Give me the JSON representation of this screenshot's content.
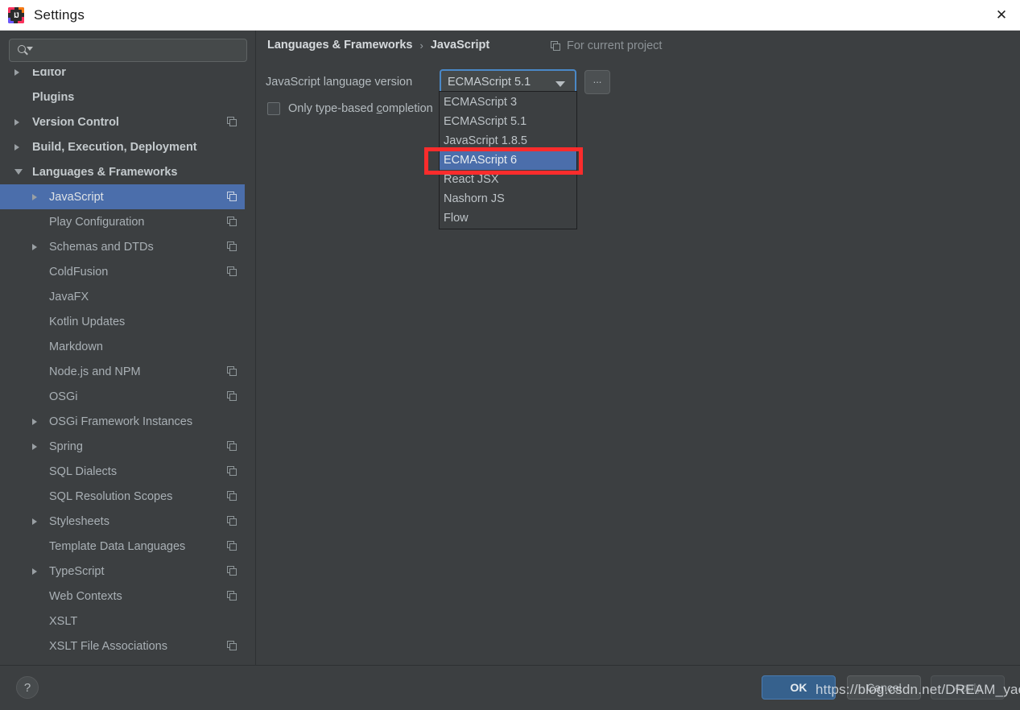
{
  "window": {
    "title": "Settings",
    "logo_icon": "intellij-idea-icon",
    "close_icon": "close-icon"
  },
  "search": {
    "icon": "search-icon",
    "value": "",
    "placeholder": ""
  },
  "sidebar": {
    "scrollbar": "vertical-scrollbar",
    "items": [
      {
        "label": "Editor",
        "level": 0,
        "bold": true,
        "arrow": "right",
        "badge": false,
        "selected": false,
        "clipped": true
      },
      {
        "label": "Plugins",
        "level": 0,
        "bold": true,
        "arrow": "none",
        "badge": false,
        "selected": false
      },
      {
        "label": "Version Control",
        "level": 0,
        "bold": true,
        "arrow": "right",
        "badge": true,
        "selected": false
      },
      {
        "label": "Build, Execution, Deployment",
        "level": 0,
        "bold": true,
        "arrow": "right",
        "badge": false,
        "selected": false
      },
      {
        "label": "Languages & Frameworks",
        "level": 0,
        "bold": true,
        "arrow": "down",
        "badge": false,
        "selected": false
      },
      {
        "label": "JavaScript",
        "level": 1,
        "bold": false,
        "arrow": "right",
        "badge": true,
        "selected": true
      },
      {
        "label": "Play Configuration",
        "level": 1,
        "bold": false,
        "arrow": "none",
        "badge": true,
        "selected": false
      },
      {
        "label": "Schemas and DTDs",
        "level": 1,
        "bold": false,
        "arrow": "right",
        "badge": true,
        "selected": false
      },
      {
        "label": "ColdFusion",
        "level": 1,
        "bold": false,
        "arrow": "none",
        "badge": true,
        "selected": false
      },
      {
        "label": "JavaFX",
        "level": 1,
        "bold": false,
        "arrow": "none",
        "badge": false,
        "selected": false
      },
      {
        "label": "Kotlin Updates",
        "level": 1,
        "bold": false,
        "arrow": "none",
        "badge": false,
        "selected": false
      },
      {
        "label": "Markdown",
        "level": 1,
        "bold": false,
        "arrow": "none",
        "badge": false,
        "selected": false
      },
      {
        "label": "Node.js and NPM",
        "level": 1,
        "bold": false,
        "arrow": "none",
        "badge": true,
        "selected": false
      },
      {
        "label": "OSGi",
        "level": 1,
        "bold": false,
        "arrow": "none",
        "badge": true,
        "selected": false
      },
      {
        "label": "OSGi Framework Instances",
        "level": 1,
        "bold": false,
        "arrow": "right",
        "badge": false,
        "selected": false
      },
      {
        "label": "Spring",
        "level": 1,
        "bold": false,
        "arrow": "right",
        "badge": true,
        "selected": false
      },
      {
        "label": "SQL Dialects",
        "level": 1,
        "bold": false,
        "arrow": "none",
        "badge": true,
        "selected": false
      },
      {
        "label": "SQL Resolution Scopes",
        "level": 1,
        "bold": false,
        "arrow": "none",
        "badge": true,
        "selected": false
      },
      {
        "label": "Stylesheets",
        "level": 1,
        "bold": false,
        "arrow": "right",
        "badge": true,
        "selected": false
      },
      {
        "label": "Template Data Languages",
        "level": 1,
        "bold": false,
        "arrow": "none",
        "badge": true,
        "selected": false
      },
      {
        "label": "TypeScript",
        "level": 1,
        "bold": false,
        "arrow": "right",
        "badge": true,
        "selected": false
      },
      {
        "label": "Web Contexts",
        "level": 1,
        "bold": false,
        "arrow": "none",
        "badge": true,
        "selected": false
      },
      {
        "label": "XSLT",
        "level": 1,
        "bold": false,
        "arrow": "none",
        "badge": false,
        "selected": false
      },
      {
        "label": "XSLT File Associations",
        "level": 1,
        "bold": false,
        "arrow": "none",
        "badge": true,
        "selected": false
      }
    ]
  },
  "content": {
    "breadcrumb": {
      "parent": "Languages & Frameworks",
      "separator": "›",
      "current": "JavaScript"
    },
    "project_note": {
      "icon": "project-scope-icon",
      "text": "For current project"
    },
    "language_version": {
      "label": "JavaScript language version",
      "selected": "ECMAScript 5.1",
      "caret_icon": "chevron-down-icon",
      "browse_label": "..."
    },
    "type_based_completion": {
      "checked": false,
      "label_before": "Only type-based ",
      "mnemonic": "c",
      "label_after": "ompletion"
    },
    "dropdown": {
      "open": true,
      "options": [
        "ECMAScript 3",
        "ECMAScript 5.1",
        "JavaScript 1.8.5",
        "ECMAScript 6",
        "React JSX",
        "Nashorn JS",
        "Flow"
      ],
      "highlighted": "ECMAScript 6",
      "highlighted_index": 3
    },
    "annotation": {
      "shape": "rectangle",
      "color": "#fb2c2c",
      "targets": "ECMAScript 6"
    }
  },
  "footer": {
    "help_icon": "question-mark-icon",
    "help_label": "?",
    "ok_label": "OK",
    "cancel_label": "Cancel",
    "apply_label": "Apply",
    "apply_enabled": false
  },
  "watermark": {
    "text": "https://blog.csdn.net/DREAM_yao"
  },
  "colors": {
    "window_bg": "#3c3f41",
    "titlebar_bg": "#ffffff",
    "selection_blue": "#4b6eab",
    "focus_blue": "#4a88c7",
    "annotation_red": "#fb2c2c",
    "ok_button_blue": "#36618d",
    "text_primary": "#b4bbbf",
    "text_muted": "#8c9296"
  }
}
